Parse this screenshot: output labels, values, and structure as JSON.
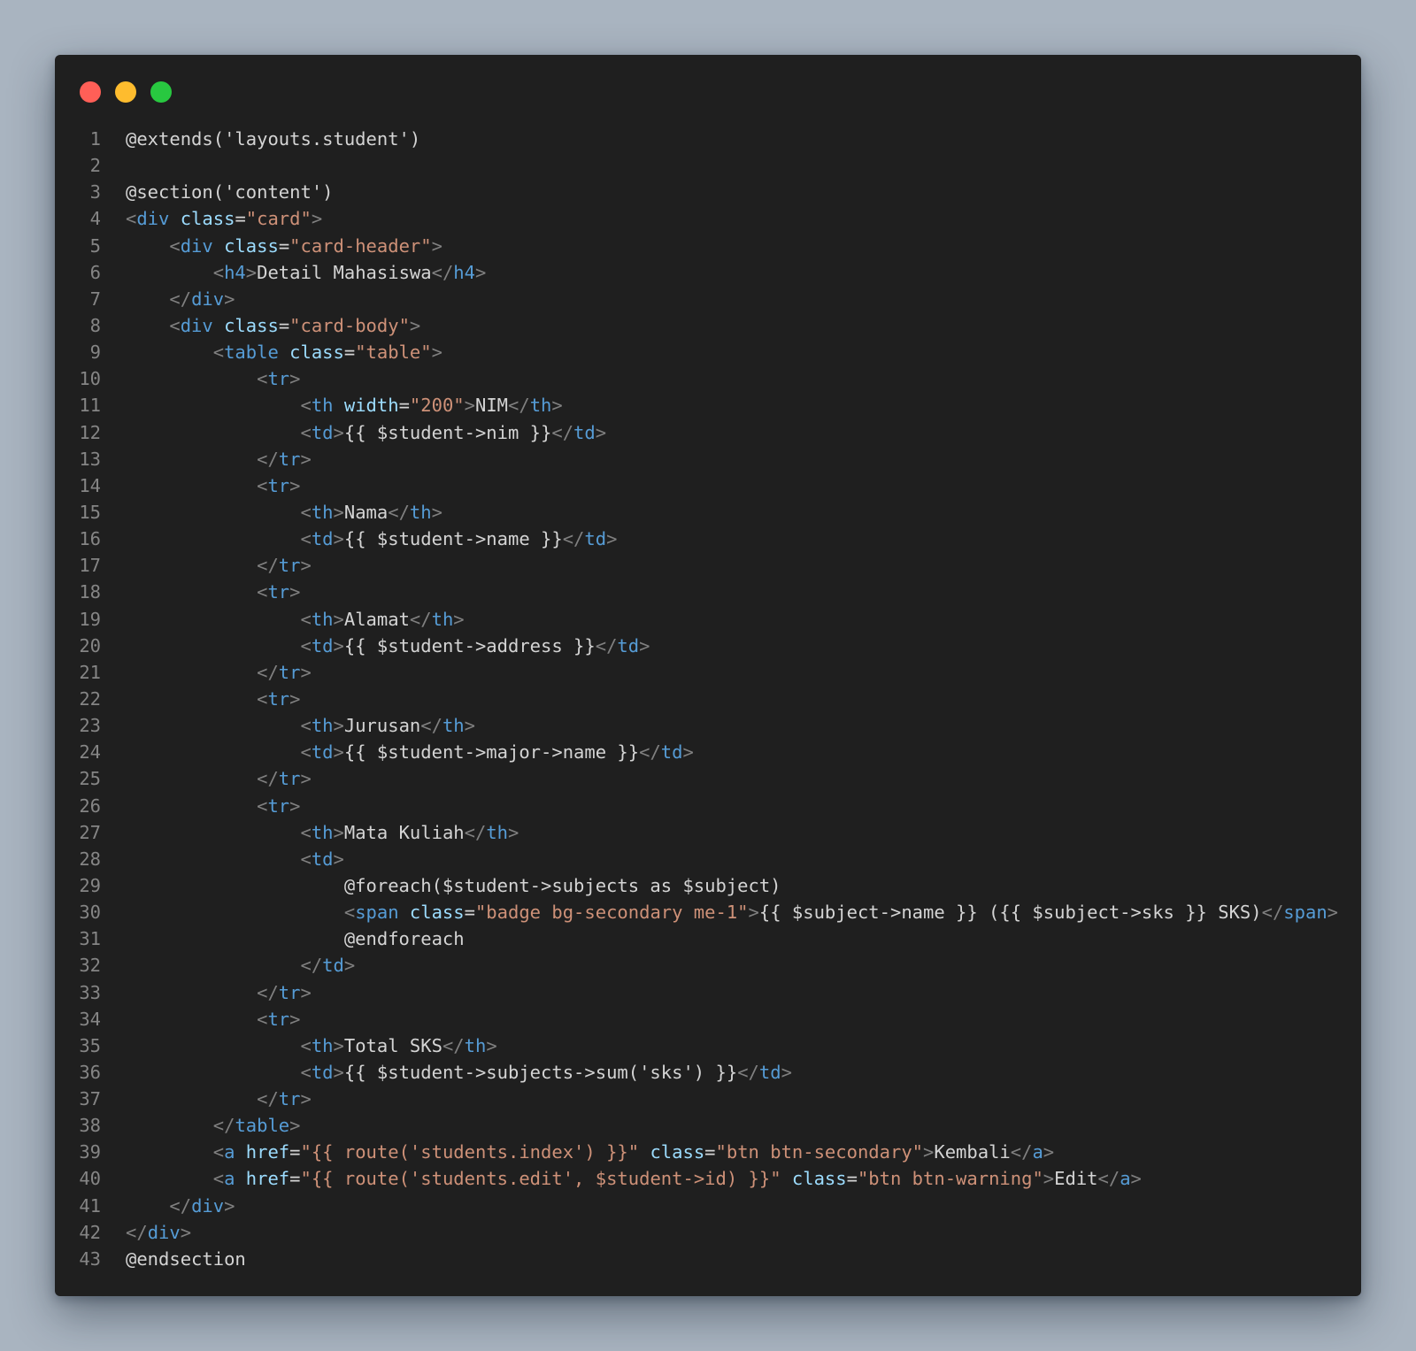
{
  "window": {
    "controls": [
      {
        "name": "close",
        "color": "#ff5f57"
      },
      {
        "name": "minimize",
        "color": "#febc2e"
      },
      {
        "name": "zoom",
        "color": "#28c840"
      }
    ]
  },
  "code_lines": [
    [
      [
        "text",
        "@extends('layouts.student')"
      ]
    ],
    [],
    [
      [
        "text",
        "@section('content')"
      ]
    ],
    [
      [
        "punct",
        "<"
      ],
      [
        "tag",
        "div"
      ],
      [
        "text",
        " "
      ],
      [
        "attr",
        "class"
      ],
      [
        "text",
        "="
      ],
      [
        "str",
        "\"card\""
      ],
      [
        "punct",
        ">"
      ]
    ],
    [
      [
        "text",
        "    "
      ],
      [
        "punct",
        "<"
      ],
      [
        "tag",
        "div"
      ],
      [
        "text",
        " "
      ],
      [
        "attr",
        "class"
      ],
      [
        "text",
        "="
      ],
      [
        "str",
        "\"card-header\""
      ],
      [
        "punct",
        ">"
      ]
    ],
    [
      [
        "text",
        "        "
      ],
      [
        "punct",
        "<"
      ],
      [
        "tag",
        "h4"
      ],
      [
        "punct",
        ">"
      ],
      [
        "text",
        "Detail Mahasiswa"
      ],
      [
        "punct",
        "</"
      ],
      [
        "tag",
        "h4"
      ],
      [
        "punct",
        ">"
      ]
    ],
    [
      [
        "text",
        "    "
      ],
      [
        "punct",
        "</"
      ],
      [
        "tag",
        "div"
      ],
      [
        "punct",
        ">"
      ]
    ],
    [
      [
        "text",
        "    "
      ],
      [
        "punct",
        "<"
      ],
      [
        "tag",
        "div"
      ],
      [
        "text",
        " "
      ],
      [
        "attr",
        "class"
      ],
      [
        "text",
        "="
      ],
      [
        "str",
        "\"card-body\""
      ],
      [
        "punct",
        ">"
      ]
    ],
    [
      [
        "text",
        "        "
      ],
      [
        "punct",
        "<"
      ],
      [
        "tag",
        "table"
      ],
      [
        "text",
        " "
      ],
      [
        "attr",
        "class"
      ],
      [
        "text",
        "="
      ],
      [
        "str",
        "\"table\""
      ],
      [
        "punct",
        ">"
      ]
    ],
    [
      [
        "text",
        "            "
      ],
      [
        "punct",
        "<"
      ],
      [
        "tag",
        "tr"
      ],
      [
        "punct",
        ">"
      ]
    ],
    [
      [
        "text",
        "                "
      ],
      [
        "punct",
        "<"
      ],
      [
        "tag",
        "th"
      ],
      [
        "text",
        " "
      ],
      [
        "attr",
        "width"
      ],
      [
        "text",
        "="
      ],
      [
        "str",
        "\"200\""
      ],
      [
        "punct",
        ">"
      ],
      [
        "text",
        "NIM"
      ],
      [
        "punct",
        "</"
      ],
      [
        "tag",
        "th"
      ],
      [
        "punct",
        ">"
      ]
    ],
    [
      [
        "text",
        "                "
      ],
      [
        "punct",
        "<"
      ],
      [
        "tag",
        "td"
      ],
      [
        "punct",
        ">"
      ],
      [
        "text",
        "{{ $student->nim }}"
      ],
      [
        "punct",
        "</"
      ],
      [
        "tag",
        "td"
      ],
      [
        "punct",
        ">"
      ]
    ],
    [
      [
        "text",
        "            "
      ],
      [
        "punct",
        "</"
      ],
      [
        "tag",
        "tr"
      ],
      [
        "punct",
        ">"
      ]
    ],
    [
      [
        "text",
        "            "
      ],
      [
        "punct",
        "<"
      ],
      [
        "tag",
        "tr"
      ],
      [
        "punct",
        ">"
      ]
    ],
    [
      [
        "text",
        "                "
      ],
      [
        "punct",
        "<"
      ],
      [
        "tag",
        "th"
      ],
      [
        "punct",
        ">"
      ],
      [
        "text",
        "Nama"
      ],
      [
        "punct",
        "</"
      ],
      [
        "tag",
        "th"
      ],
      [
        "punct",
        ">"
      ]
    ],
    [
      [
        "text",
        "                "
      ],
      [
        "punct",
        "<"
      ],
      [
        "tag",
        "td"
      ],
      [
        "punct",
        ">"
      ],
      [
        "text",
        "{{ $student->name }}"
      ],
      [
        "punct",
        "</"
      ],
      [
        "tag",
        "td"
      ],
      [
        "punct",
        ">"
      ]
    ],
    [
      [
        "text",
        "            "
      ],
      [
        "punct",
        "</"
      ],
      [
        "tag",
        "tr"
      ],
      [
        "punct",
        ">"
      ]
    ],
    [
      [
        "text",
        "            "
      ],
      [
        "punct",
        "<"
      ],
      [
        "tag",
        "tr"
      ],
      [
        "punct",
        ">"
      ]
    ],
    [
      [
        "text",
        "                "
      ],
      [
        "punct",
        "<"
      ],
      [
        "tag",
        "th"
      ],
      [
        "punct",
        ">"
      ],
      [
        "text",
        "Alamat"
      ],
      [
        "punct",
        "</"
      ],
      [
        "tag",
        "th"
      ],
      [
        "punct",
        ">"
      ]
    ],
    [
      [
        "text",
        "                "
      ],
      [
        "punct",
        "<"
      ],
      [
        "tag",
        "td"
      ],
      [
        "punct",
        ">"
      ],
      [
        "text",
        "{{ $student->address }}"
      ],
      [
        "punct",
        "</"
      ],
      [
        "tag",
        "td"
      ],
      [
        "punct",
        ">"
      ]
    ],
    [
      [
        "text",
        "            "
      ],
      [
        "punct",
        "</"
      ],
      [
        "tag",
        "tr"
      ],
      [
        "punct",
        ">"
      ]
    ],
    [
      [
        "text",
        "            "
      ],
      [
        "punct",
        "<"
      ],
      [
        "tag",
        "tr"
      ],
      [
        "punct",
        ">"
      ]
    ],
    [
      [
        "text",
        "                "
      ],
      [
        "punct",
        "<"
      ],
      [
        "tag",
        "th"
      ],
      [
        "punct",
        ">"
      ],
      [
        "text",
        "Jurusan"
      ],
      [
        "punct",
        "</"
      ],
      [
        "tag",
        "th"
      ],
      [
        "punct",
        ">"
      ]
    ],
    [
      [
        "text",
        "                "
      ],
      [
        "punct",
        "<"
      ],
      [
        "tag",
        "td"
      ],
      [
        "punct",
        ">"
      ],
      [
        "text",
        "{{ $student->major->name }}"
      ],
      [
        "punct",
        "</"
      ],
      [
        "tag",
        "td"
      ],
      [
        "punct",
        ">"
      ]
    ],
    [
      [
        "text",
        "            "
      ],
      [
        "punct",
        "</"
      ],
      [
        "tag",
        "tr"
      ],
      [
        "punct",
        ">"
      ]
    ],
    [
      [
        "text",
        "            "
      ],
      [
        "punct",
        "<"
      ],
      [
        "tag",
        "tr"
      ],
      [
        "punct",
        ">"
      ]
    ],
    [
      [
        "text",
        "                "
      ],
      [
        "punct",
        "<"
      ],
      [
        "tag",
        "th"
      ],
      [
        "punct",
        ">"
      ],
      [
        "text",
        "Mata Kuliah"
      ],
      [
        "punct",
        "</"
      ],
      [
        "tag",
        "th"
      ],
      [
        "punct",
        ">"
      ]
    ],
    [
      [
        "text",
        "                "
      ],
      [
        "punct",
        "<"
      ],
      [
        "tag",
        "td"
      ],
      [
        "punct",
        ">"
      ]
    ],
    [
      [
        "text",
        "                    @foreach($student->subjects as $subject)"
      ]
    ],
    [
      [
        "text",
        "                    "
      ],
      [
        "punct",
        "<"
      ],
      [
        "tag",
        "span"
      ],
      [
        "text",
        " "
      ],
      [
        "attr",
        "class"
      ],
      [
        "text",
        "="
      ],
      [
        "str",
        "\"badge bg-secondary me-1\""
      ],
      [
        "punct",
        ">"
      ],
      [
        "text",
        "{{ $subject->name }} ({{ $subject->sks }} SKS)"
      ],
      [
        "punct",
        "</"
      ],
      [
        "tag",
        "span"
      ],
      [
        "punct",
        ">"
      ]
    ],
    [
      [
        "text",
        "                    @endforeach"
      ]
    ],
    [
      [
        "text",
        "                "
      ],
      [
        "punct",
        "</"
      ],
      [
        "tag",
        "td"
      ],
      [
        "punct",
        ">"
      ]
    ],
    [
      [
        "text",
        "            "
      ],
      [
        "punct",
        "</"
      ],
      [
        "tag",
        "tr"
      ],
      [
        "punct",
        ">"
      ]
    ],
    [
      [
        "text",
        "            "
      ],
      [
        "punct",
        "<"
      ],
      [
        "tag",
        "tr"
      ],
      [
        "punct",
        ">"
      ]
    ],
    [
      [
        "text",
        "                "
      ],
      [
        "punct",
        "<"
      ],
      [
        "tag",
        "th"
      ],
      [
        "punct",
        ">"
      ],
      [
        "text",
        "Total SKS"
      ],
      [
        "punct",
        "</"
      ],
      [
        "tag",
        "th"
      ],
      [
        "punct",
        ">"
      ]
    ],
    [
      [
        "text",
        "                "
      ],
      [
        "punct",
        "<"
      ],
      [
        "tag",
        "td"
      ],
      [
        "punct",
        ">"
      ],
      [
        "text",
        "{{ $student->subjects->sum('sks') }}"
      ],
      [
        "punct",
        "</"
      ],
      [
        "tag",
        "td"
      ],
      [
        "punct",
        ">"
      ]
    ],
    [
      [
        "text",
        "            "
      ],
      [
        "punct",
        "</"
      ],
      [
        "tag",
        "tr"
      ],
      [
        "punct",
        ">"
      ]
    ],
    [
      [
        "text",
        "        "
      ],
      [
        "punct",
        "</"
      ],
      [
        "tag",
        "table"
      ],
      [
        "punct",
        ">"
      ]
    ],
    [
      [
        "text",
        "        "
      ],
      [
        "punct",
        "<"
      ],
      [
        "tag",
        "a"
      ],
      [
        "text",
        " "
      ],
      [
        "attr",
        "href"
      ],
      [
        "text",
        "="
      ],
      [
        "str",
        "\"{{ route('students.index') }}\""
      ],
      [
        "text",
        " "
      ],
      [
        "attr",
        "class"
      ],
      [
        "text",
        "="
      ],
      [
        "str",
        "\"btn btn-secondary\""
      ],
      [
        "punct",
        ">"
      ],
      [
        "text",
        "Kembali"
      ],
      [
        "punct",
        "</"
      ],
      [
        "tag",
        "a"
      ],
      [
        "punct",
        ">"
      ]
    ],
    [
      [
        "text",
        "        "
      ],
      [
        "punct",
        "<"
      ],
      [
        "tag",
        "a"
      ],
      [
        "text",
        " "
      ],
      [
        "attr",
        "href"
      ],
      [
        "text",
        "="
      ],
      [
        "str",
        "\"{{ route('students.edit', $student->id) }}\""
      ],
      [
        "text",
        " "
      ],
      [
        "attr",
        "class"
      ],
      [
        "text",
        "="
      ],
      [
        "str",
        "\"btn btn-warning\""
      ],
      [
        "punct",
        ">"
      ],
      [
        "text",
        "Edit"
      ],
      [
        "punct",
        "</"
      ],
      [
        "tag",
        "a"
      ],
      [
        "punct",
        ">"
      ]
    ],
    [
      [
        "text",
        "    "
      ],
      [
        "punct",
        "</"
      ],
      [
        "tag",
        "div"
      ],
      [
        "punct",
        ">"
      ]
    ],
    [
      [
        "punct",
        "</"
      ],
      [
        "tag",
        "div"
      ],
      [
        "punct",
        ">"
      ]
    ],
    [
      [
        "text",
        "@endsection"
      ]
    ]
  ]
}
